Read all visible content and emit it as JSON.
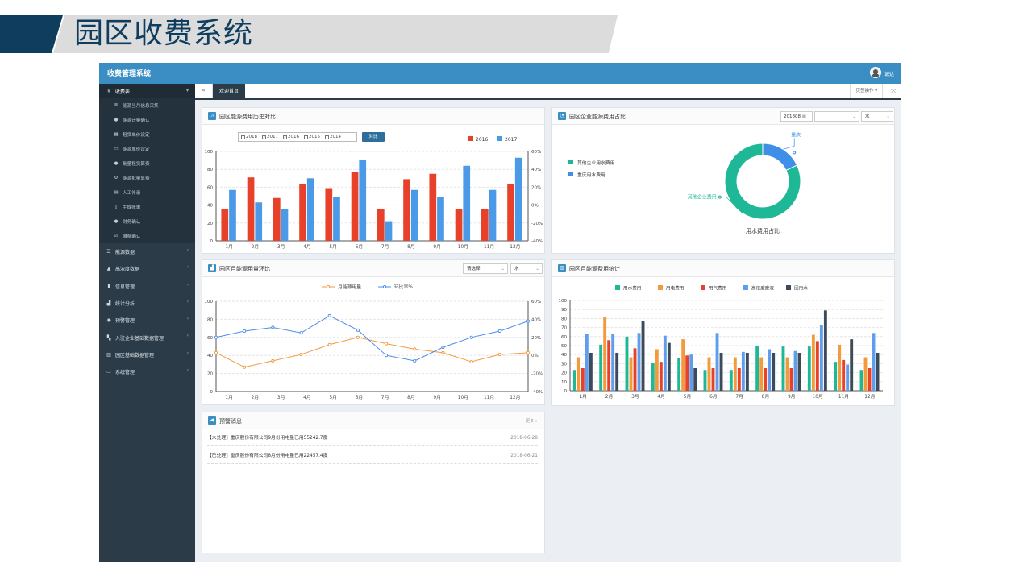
{
  "banner": {
    "title": "园区收费系统"
  },
  "app": {
    "title": "收费管理系统",
    "user": "诚达"
  },
  "sidebar": {
    "active_group": "收费表",
    "sub_items": [
      "能源当月信息采集",
      "能源计量确认",
      "租赁单价设定",
      "能源单价设定",
      "批量租赁算费",
      "能源批量算费",
      "人工补录",
      "生成账单",
      "财务确认",
      "缴费确认"
    ],
    "groups": [
      "能源数据",
      "高浓度数据",
      "信息管理",
      "统计分析",
      "预警管理",
      "入驻企业基础数据管理",
      "园区基础数据管理",
      "系统管理"
    ]
  },
  "tabs": {
    "active": "欢迎首页",
    "ops": "页签操作 ▾"
  },
  "panel1": {
    "title": "园区能源费用历史对比",
    "checks": [
      {
        "label": "2018",
        "checked": false
      },
      {
        "label": "2017",
        "checked": true
      },
      {
        "label": "2016",
        "checked": true
      },
      {
        "label": "2015",
        "checked": false
      },
      {
        "label": "2014",
        "checked": false
      }
    ],
    "compare_button": "对比"
  },
  "panel2": {
    "title": "园区企业能源费用占比",
    "date_value": "201808",
    "select_type": "水",
    "legend": [
      "其他企业用水费用",
      "重庆用水费用"
    ],
    "label_outer_left": "其他企业费用",
    "label_outer_right": "重庆",
    "caption": "用水费用占比"
  },
  "panel3": {
    "title": "园区月能源用量环比",
    "select_placeholder": "请选择",
    "select_type": "水"
  },
  "panel4": {
    "title": "园区月能源费用统计"
  },
  "panel5": {
    "title": "预警消息",
    "more": "更多 »",
    "messages": [
      {
        "text": "【未处理】重庆股份有限公司9月份用电量已用55242.7度",
        "date": "2018-06-28"
      },
      {
        "text": "【已处理】重庆股份有限公司8月份用电量已用22457.4度",
        "date": "2018-06-21"
      }
    ]
  },
  "chart_data": [
    {
      "type": "bar",
      "categories": [
        "1月",
        "2月",
        "3月",
        "4月",
        "5月",
        "6月",
        "7月",
        "8月",
        "9月",
        "10月",
        "11月",
        "12月"
      ],
      "series": [
        {
          "name": "2016",
          "color": "#e8412a",
          "values": [
            36,
            71,
            48,
            64,
            59,
            77,
            36,
            69,
            75,
            36,
            36,
            64
          ]
        },
        {
          "name": "2017",
          "color": "#4a9ae8",
          "values": [
            57,
            43,
            36,
            70,
            49,
            91,
            22,
            57,
            49,
            84,
            57,
            93
          ]
        }
      ],
      "ylim": [
        0,
        100
      ],
      "yticks": [
        0,
        20,
        40,
        60,
        80,
        100
      ],
      "y2ticks": [
        "-40%",
        "-20%",
        "0%",
        "20%",
        "40%",
        "60%"
      ],
      "legend": "top-right"
    },
    {
      "type": "pie",
      "slices": [
        {
          "name": "其他企业用水费用",
          "color": "#1eb896",
          "value": 82
        },
        {
          "name": "重庆用水费用",
          "color": "#3f8ee8",
          "value": 18
        }
      ],
      "legend": "left"
    },
    {
      "type": "line",
      "categories": [
        "1月",
        "2月",
        "3月",
        "4月",
        "5月",
        "6月",
        "7月",
        "8月",
        "9月",
        "10月",
        "11月",
        "12月"
      ],
      "series": [
        {
          "name": "月能源用量",
          "color": "#f39a3b",
          "axis": "left",
          "values": [
            43,
            27,
            34,
            41,
            52,
            60,
            53,
            47,
            43,
            33,
            41,
            43
          ]
        },
        {
          "name": "环比率%",
          "color": "#4a8ee8",
          "axis": "right",
          "values": [
            20,
            27,
            31,
            25,
            44,
            28,
            0,
            -6,
            9,
            20,
            27,
            38
          ]
        }
      ],
      "ylim": [
        0,
        100
      ],
      "y2lim": [
        -40,
        60
      ],
      "yticks": [
        0,
        20,
        40,
        60,
        80,
        100
      ],
      "y2ticks": [
        "-40%",
        "-20%",
        "0%",
        "20%",
        "40%",
        "60%"
      ],
      "legend": "top-center"
    },
    {
      "type": "bar",
      "categories": [
        "1月",
        "2月",
        "3月",
        "4月",
        "5月",
        "6月",
        "7月",
        "8月",
        "9月",
        "10月",
        "11月",
        "12月"
      ],
      "series": [
        {
          "name": "用水费用",
          "color": "#1eb896",
          "values": [
            23,
            51,
            60,
            31,
            36,
            23,
            23,
            50,
            49,
            49,
            32,
            23
          ]
        },
        {
          "name": "用电费用",
          "color": "#f39a3b",
          "values": [
            37,
            82,
            37,
            46,
            57,
            37,
            37,
            37,
            37,
            62,
            51,
            37
          ]
        },
        {
          "name": "用气费用",
          "color": "#e8412a",
          "values": [
            25,
            56,
            47,
            32,
            39,
            25,
            25,
            25,
            25,
            55,
            34,
            25
          ]
        },
        {
          "name": "高浓度废液",
          "color": "#5f9ded",
          "values": [
            63,
            63,
            64,
            61,
            40,
            64,
            43,
            46,
            44,
            73,
            29,
            64
          ]
        },
        {
          "name": "回用水",
          "color": "#3c4a59",
          "values": [
            42,
            42,
            77,
            53,
            25,
            42,
            42,
            42,
            42,
            89,
            57,
            42
          ]
        }
      ],
      "ylim": [
        0,
        100
      ],
      "yticks": [
        0,
        10,
        20,
        30,
        40,
        50,
        60,
        70,
        80,
        90,
        100
      ],
      "legend": "top-center"
    }
  ]
}
